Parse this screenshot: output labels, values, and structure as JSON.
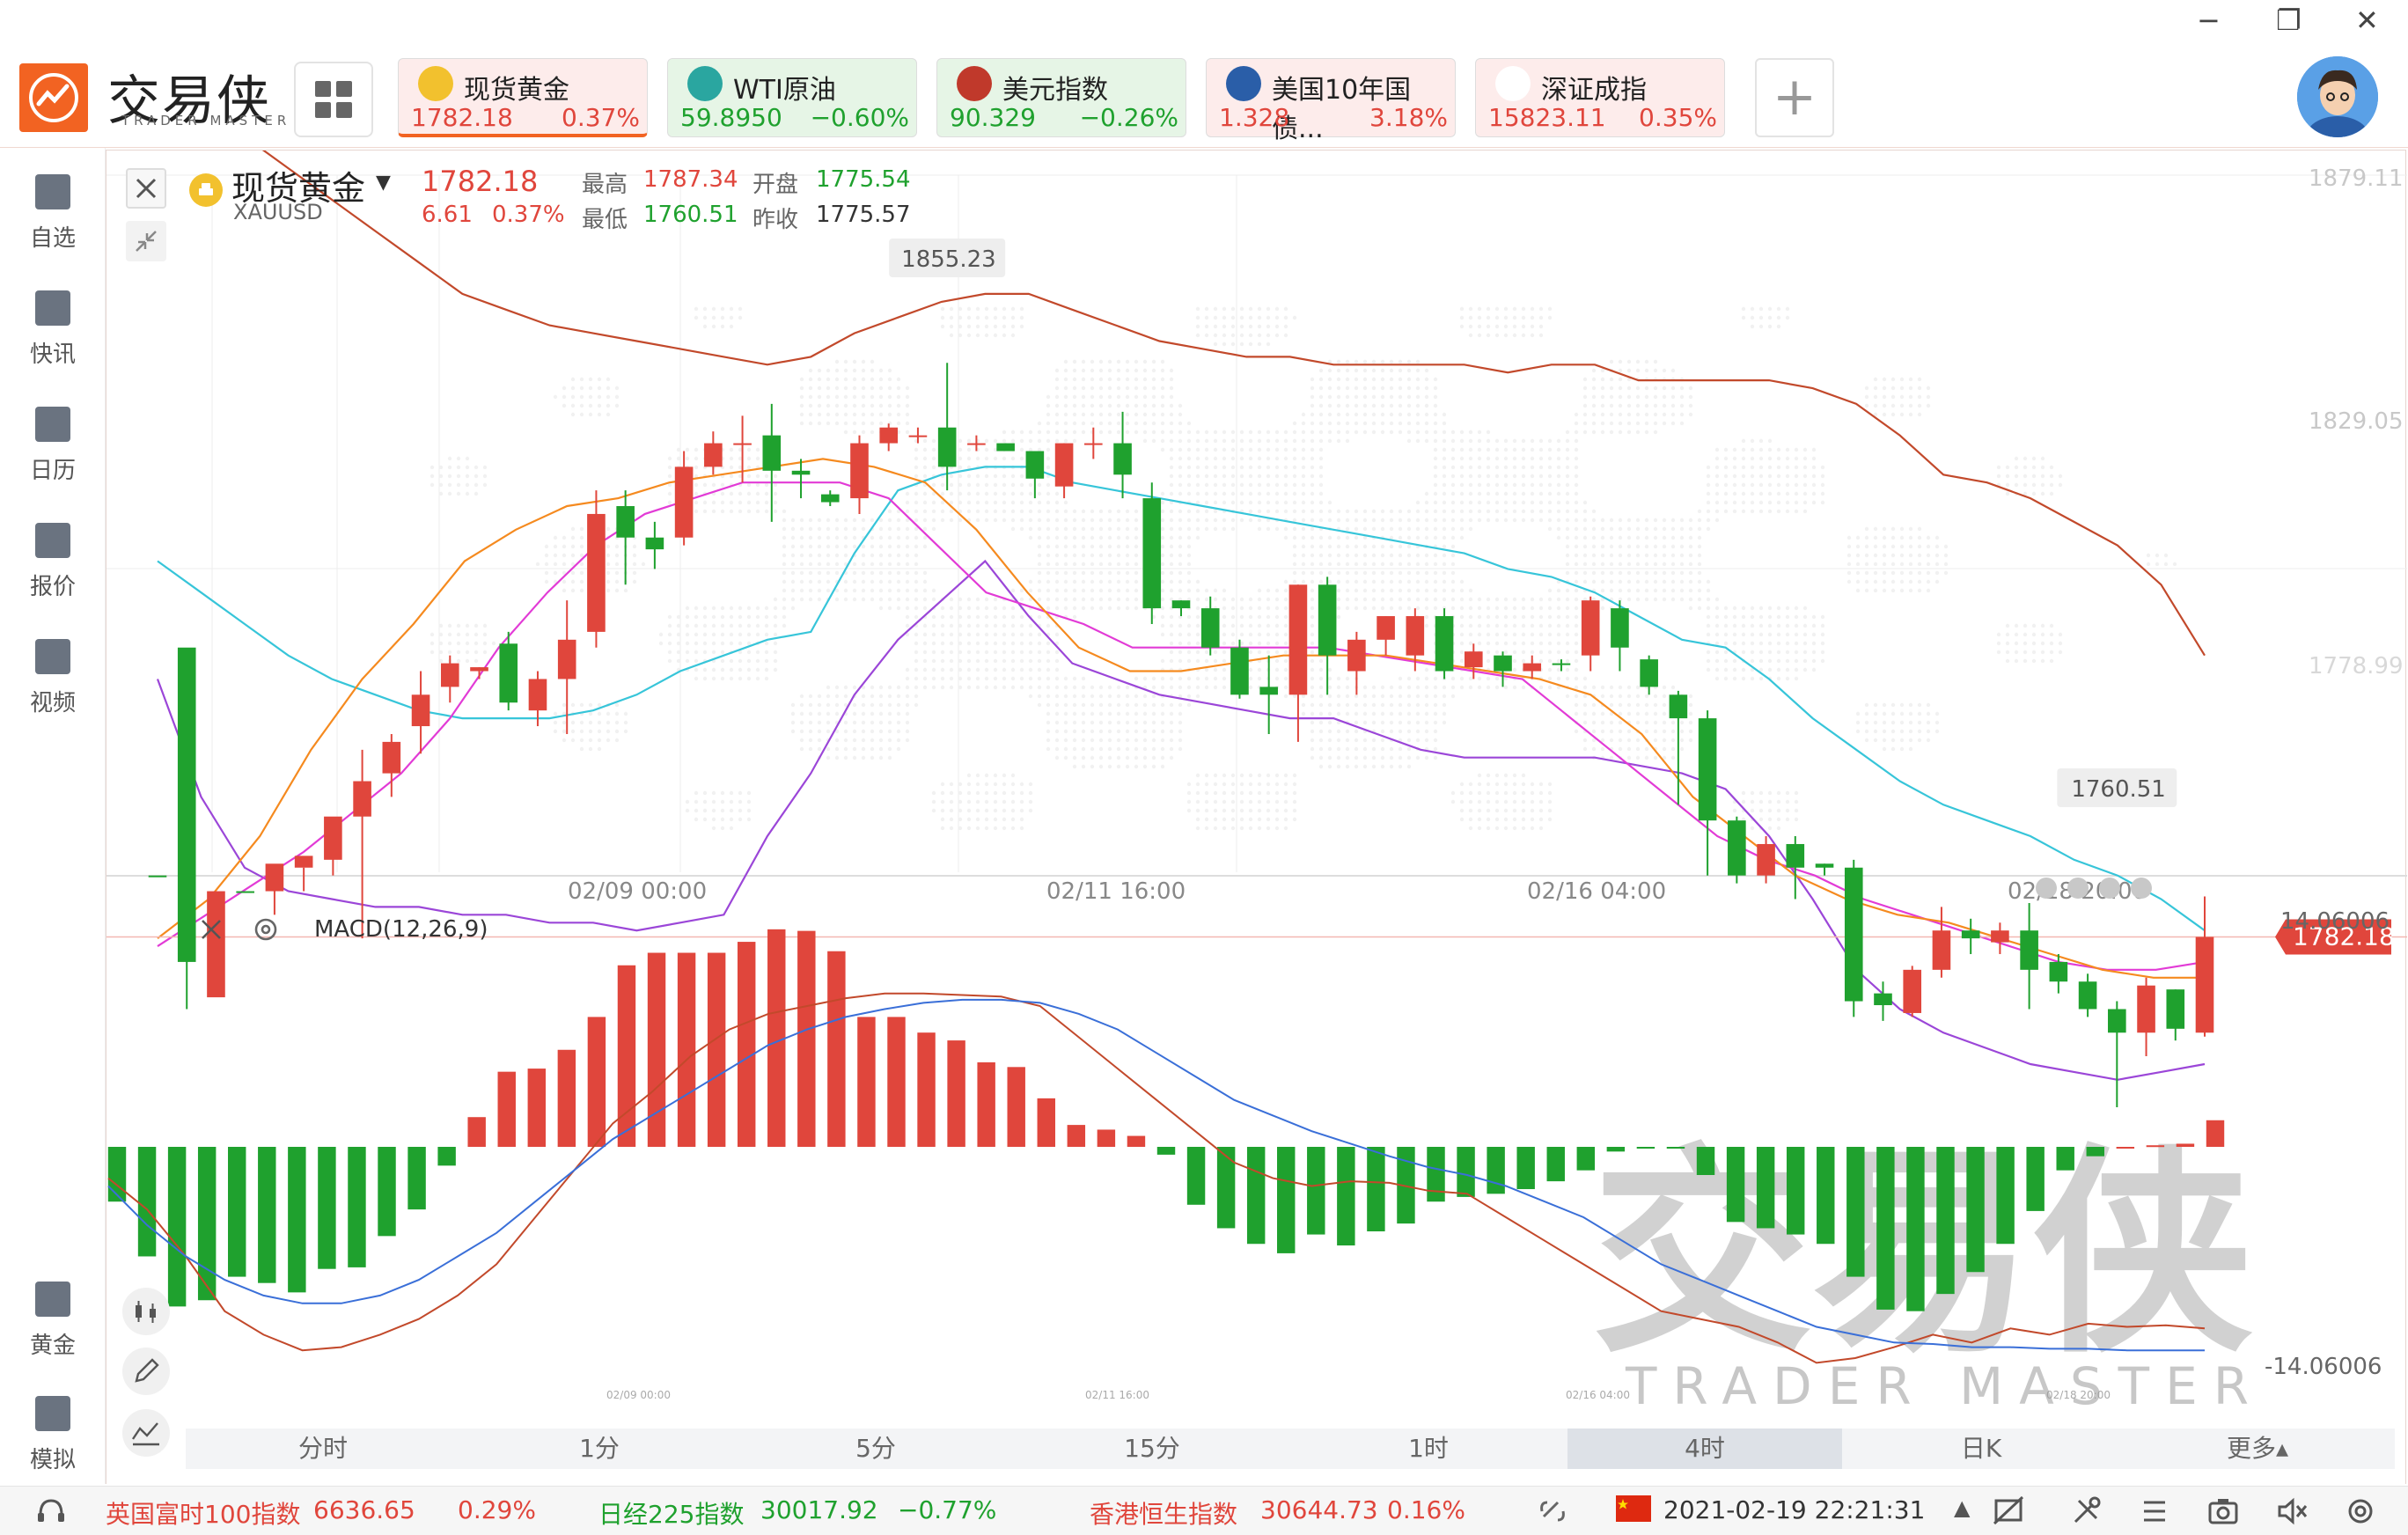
{
  "window": {
    "minimize": "−",
    "restore": "❐",
    "close": "✕"
  },
  "logo": {
    "text": "交易侠",
    "subtitle": "TRADER MASTER"
  },
  "tickers": [
    {
      "name": "现货黄金",
      "price": "1782.18",
      "change": "0.37%",
      "dir": "up",
      "icon": "gold-icon"
    },
    {
      "name": "WTI原油",
      "price": "59.8950",
      "change": "−0.60%",
      "dir": "down",
      "icon": "oil-icon"
    },
    {
      "name": "美元指数",
      "price": "90.329",
      "change": "−0.26%",
      "dir": "down",
      "icon": "us-flag-icon"
    },
    {
      "name": "美国10年国债...",
      "price": "1.328",
      "change": "3.18%",
      "dir": "up",
      "icon": "bond-icon"
    },
    {
      "name": "深证成指",
      "price": "15823.11",
      "change": "0.35%",
      "dir": "up",
      "icon": "szse-icon"
    }
  ],
  "add_label": "+",
  "sidebar": {
    "items": [
      {
        "label": "自选",
        "icon": "bookmark-icon"
      },
      {
        "label": "快讯",
        "icon": "news-icon"
      },
      {
        "label": "日历",
        "icon": "calendar-icon"
      },
      {
        "label": "报价",
        "icon": "quote-icon"
      },
      {
        "label": "视频",
        "icon": "video-icon"
      }
    ],
    "bottom_items": [
      {
        "label": "黄金",
        "icon": "sge-icon"
      },
      {
        "label": "模拟",
        "icon": "wallet-icon"
      }
    ]
  },
  "symbol": {
    "name": "现货黄金",
    "code": "XAUUSD",
    "price": "1782.18",
    "change": "6.61",
    "change_pct": "0.37%",
    "high_label": "最高",
    "high": "1787.34",
    "open_label": "开盘",
    "open": "1775.54",
    "low_label": "最低",
    "low": "1760.51",
    "prev_label": "昨收",
    "prev": "1775.57"
  },
  "price_axis": {
    "top": "1879.11",
    "mid": "1829.05",
    "current": "1782.18",
    "behind": "1778.99"
  },
  "annotations": {
    "max": "1855.23",
    "min": "1760.51"
  },
  "x_labels": [
    "02/09 00:00",
    "02/11 16:00",
    "02/16 04:00",
    "02/18 20:00"
  ],
  "macd": {
    "title": "MACD(12,26,9)",
    "top": "14.06006",
    "bottom": "-14.06006"
  },
  "watermark": {
    "main": "交易侠",
    "sub": "TRADER MASTER"
  },
  "timeframes": [
    "分时",
    "1分",
    "5分",
    "15分",
    "1时",
    "4时",
    "日K",
    "更多▴"
  ],
  "active_timeframe": "4时",
  "status": [
    {
      "name": "英国富时100指数",
      "value": "6636.65",
      "change": "0.29%",
      "dir": "up"
    },
    {
      "name": "日经225指数",
      "value": "30017.92",
      "change": "−0.77%",
      "dir": "down"
    },
    {
      "name": "香港恒生指数",
      "value": "30644.73",
      "change": "0.16%",
      "dir": "up"
    }
  ],
  "datetime": "2021-02-19 22:21:31",
  "colors": {
    "up": "#e0463c",
    "down": "#1fa12e",
    "accent": "#f26322"
  },
  "chart_data": {
    "type": "candlestick",
    "candles": [
      [
        1790.0,
        1790.0,
        1790.0,
        1790.0,
        "g"
      ],
      [
        1779.0,
        1819.0,
        1818.0,
        1773.0,
        "g"
      ],
      [
        1774.5,
        1788.0,
        1779.0,
        1775.0,
        "r"
      ],
      [
        1788.0,
        1788.0,
        1787.0,
        1787.0,
        "g"
      ],
      [
        1788.0,
        1791.5,
        1788.5,
        1785.0,
        "r"
      ],
      [
        1791.0,
        1792.5,
        1788.0,
        1791.0,
        "r"
      ],
      [
        1792.0,
        1797.5,
        1793.5,
        1790.0,
        "r"
      ],
      [
        1797.5,
        1802.0,
        1806.0,
        1782.0,
        "r"
      ],
      [
        1803.0,
        1807.0,
        1808.0,
        1800.0,
        "r"
      ],
      [
        1809.0,
        1813.0,
        1816.0,
        1805.5,
        "r"
      ],
      [
        1814.0,
        1817.0,
        1818.0,
        1812.0,
        "r"
      ],
      [
        1816.0,
        1816.5,
        1816.5,
        1815.0,
        "r"
      ],
      [
        1819.5,
        1812.0,
        1821.0,
        1811.0,
        "g"
      ],
      [
        1811.0,
        1815.0,
        1816.0,
        1809.0,
        "r"
      ],
      [
        1815.0,
        1820.0,
        1825.0,
        1808.0,
        "r"
      ],
      [
        1821.0,
        1836.0,
        1839.0,
        1819.0,
        "r"
      ],
      [
        1837.0,
        1833.0,
        1839.0,
        1827.0,
        "g"
      ],
      [
        1833.0,
        1831.5,
        1835.0,
        1829.0,
        "g"
      ],
      [
        1833.0,
        1842.0,
        1844.0,
        1832.0,
        "r"
      ],
      [
        1842.0,
        1845.0,
        1846.5,
        1841.0,
        "r"
      ],
      [
        1845.0,
        1845.0,
        1848.5,
        1840.0,
        "r"
      ],
      [
        1846.0,
        1841.5,
        1850.0,
        1835.0,
        "g"
      ],
      [
        1841.5,
        1841.0,
        1843.0,
        1838.0,
        "g"
      ],
      [
        1838.5,
        1837.5,
        1839.0,
        1837.0,
        "g"
      ],
      [
        1838.0,
        1845.0,
        1846.0,
        1836.0,
        "r"
      ],
      [
        1845.0,
        1847.0,
        1847.5,
        1844.0,
        "r"
      ],
      [
        1846.0,
        1846.0,
        1847.0,
        1845.0,
        "r"
      ],
      [
        1847.0,
        1842.0,
        1855.23,
        1839.0,
        "g"
      ],
      [
        1845.0,
        1845.0,
        1846.0,
        1844.0,
        "r"
      ],
      [
        1845.0,
        1844.0,
        1845.0,
        1844.0,
        "g"
      ],
      [
        1844.0,
        1840.5,
        1844.0,
        1838.0,
        "g"
      ],
      [
        1839.5,
        1845.0,
        1845.0,
        1838.0,
        "r"
      ],
      [
        1845.0,
        1845.0,
        1847.0,
        1843.0,
        "r"
      ],
      [
        1845.0,
        1841.0,
        1849.0,
        1838.0,
        "g"
      ],
      [
        1838.0,
        1824.0,
        1840.0,
        1822.0,
        "g"
      ],
      [
        1825.0,
        1824.0,
        1825.0,
        1823.0,
        "g"
      ],
      [
        1824.0,
        1819.0,
        1825.5,
        1818.0,
        "g"
      ],
      [
        1819.0,
        1813.0,
        1820.0,
        1812.5,
        "g"
      ],
      [
        1814.0,
        1813.0,
        1818.0,
        1808.0,
        "g"
      ],
      [
        1813.0,
        1827.0,
        1827.0,
        1807.0,
        "r"
      ],
      [
        1827.0,
        1818.0,
        1828.0,
        1813.0,
        "g"
      ],
      [
        1816.0,
        1820.0,
        1821.0,
        1813.0,
        "r"
      ],
      [
        1820.0,
        1823.0,
        1823.0,
        1818.0,
        "r"
      ],
      [
        1818.0,
        1823.0,
        1824.0,
        1816.0,
        "r"
      ],
      [
        1823.0,
        1816.0,
        1824.0,
        1815.0,
        "g"
      ],
      [
        1816.5,
        1818.5,
        1819.5,
        1815.0,
        "r"
      ],
      [
        1818.0,
        1816.0,
        1818.5,
        1814.0,
        "g"
      ],
      [
        1816.0,
        1817.0,
        1818.0,
        1815.0,
        "r"
      ],
      [
        1817.0,
        1817.0,
        1817.5,
        1816.0,
        "g"
      ],
      [
        1818.0,
        1825.0,
        1825.5,
        1816.0,
        "r"
      ],
      [
        1824.0,
        1819.0,
        1825.0,
        1816.0,
        "g"
      ],
      [
        1817.5,
        1814.0,
        1818.0,
        1813.0,
        "g"
      ],
      [
        1813.0,
        1810.0,
        1813.5,
        1799.0,
        "g"
      ],
      [
        1810.0,
        1797.0,
        1811.0,
        1790.0,
        "g"
      ],
      [
        1797.0,
        1790.0,
        1797.5,
        1789.0,
        "g"
      ],
      [
        1790.0,
        1794.0,
        1795.0,
        1789.0,
        "r"
      ],
      [
        1794.0,
        1791.0,
        1795.0,
        1787.0,
        "g"
      ],
      [
        1791.5,
        1791.0,
        1791.5,
        1790.0,
        "g"
      ],
      [
        1791.0,
        1774.0,
        1792.0,
        1772.0,
        "g"
      ],
      [
        1775.0,
        1773.5,
        1776.5,
        1771.5,
        "g"
      ],
      [
        1772.5,
        1778.0,
        1778.5,
        1772.0,
        "r"
      ],
      [
        1778.0,
        1783.0,
        1786.0,
        1777.0,
        "r"
      ],
      [
        1783.0,
        1782.0,
        1784.5,
        1780.0,
        "g"
      ],
      [
        1781.5,
        1783.0,
        1784.0,
        1780.0,
        "r"
      ],
      [
        1783.0,
        1778.0,
        1786.5,
        1773.0,
        "g"
      ],
      [
        1779.0,
        1776.5,
        1780.0,
        1775.0,
        "g"
      ],
      [
        1776.5,
        1773.0,
        1777.5,
        1772.0,
        "g"
      ],
      [
        1773.0,
        1770.0,
        1774.0,
        1760.51,
        "g"
      ],
      [
        1770.0,
        1776.0,
        1777.0,
        1767.0,
        "r"
      ],
      [
        1775.5,
        1770.5,
        1775.5,
        1769.0,
        "g"
      ],
      [
        1770.0,
        1782.18,
        1787.34,
        1769.5,
        "r"
      ]
    ],
    "macd_hist": [
      -3.5,
      -7,
      -10.2,
      -9.8,
      -8.3,
      -8.7,
      -9.3,
      -7.8,
      -7.7,
      -5.7,
      -4,
      -1.2,
      1.9,
      4.8,
      5,
      6.2,
      8.3,
      11.6,
      12.4,
      12.4,
      12.4,
      13.1,
      13.9,
      13.8,
      12.5,
      8.3,
      8.3,
      7.3,
      6.8,
      5.4,
      5.1,
      3.1,
      1.4,
      1.1,
      0.7,
      -0.5,
      -3.7,
      -5.2,
      -6.2,
      -6.8,
      -5.6,
      -6.3,
      -5.4,
      -4.9,
      -3.5,
      -3.2,
      -3,
      -2.7,
      -2.2,
      -1.5,
      -0.3,
      -0.1,
      -0.1,
      -1.8,
      -4.8,
      -5.2,
      -5.6,
      -6.2,
      -8.3,
      -10.4,
      -10.5,
      -9.4,
      -8,
      -6.2,
      -4.1,
      -1.5,
      -0.6,
      0,
      0.1,
      0.2,
      1.7
    ],
    "dif": [
      -2.0,
      -4.0,
      -7.0,
      -10.5,
      -12.0,
      -13.0,
      -12.8,
      -12.0,
      -11.0,
      -9.5,
      -7.5,
      -4.5,
      -1.5,
      1.5,
      3.5,
      5.8,
      7.5,
      8.5,
      9.0,
      9.5,
      9.8,
      9.8,
      9.7,
      9.6,
      9.0,
      7.0,
      5.0,
      3.0,
      1.0,
      -1.0,
      -2.0,
      -2.5,
      -2.2,
      -2.3,
      -2.8,
      -3.0,
      -4.5,
      -6.0,
      -7.5,
      -9.0,
      -10.5,
      -11.0,
      -11.5,
      -12.5,
      -13.8,
      -13.5,
      -12.8,
      -12.0,
      -12.5,
      -11.6,
      -12.0,
      -11.3,
      -11.5,
      -11.4,
      -11.6
    ],
    "dea": [
      -2.5,
      -5.0,
      -7.0,
      -8.5,
      -9.5,
      -10.0,
      -10.0,
      -9.5,
      -8.5,
      -7.0,
      -5.5,
      -3.5,
      -1.5,
      0.5,
      2.0,
      3.5,
      5.0,
      6.5,
      7.5,
      8.3,
      8.8,
      9.2,
      9.4,
      9.4,
      9.2,
      8.5,
      7.5,
      6.0,
      4.5,
      3.0,
      2.0,
      1.0,
      0.2,
      -0.6,
      -1.3,
      -1.8,
      -2.5,
      -3.5,
      -4.5,
      -6.0,
      -7.5,
      -8.5,
      -9.5,
      -10.5,
      -11.5,
      -12.0,
      -12.5,
      -12.6,
      -12.8,
      -12.8,
      -12.9,
      -12.9,
      -13.0,
      -13.0,
      -13.0
    ],
    "boll_upper": [
      1888,
      1886,
      1884,
      1880,
      1876,
      1872,
      1868,
      1864,
      1862,
      1860,
      1859,
      1858,
      1857,
      1856,
      1855,
      1856,
      1859,
      1861,
      1863,
      1864,
      1864,
      1862,
      1860,
      1858,
      1857,
      1856,
      1856,
      1855,
      1855,
      1855,
      1855,
      1854,
      1855,
      1855,
      1853,
      1853,
      1853,
      1853,
      1852,
      1850,
      1846,
      1841,
      1840,
      1838,
      1835,
      1832,
      1827,
      1818
    ],
    "boll_mid": [
      1830,
      1826,
      1822,
      1818,
      1815,
      1813,
      1811,
      1810,
      1810,
      1810,
      1811,
      1813,
      1816,
      1818,
      1820,
      1821,
      1831,
      1839,
      1841,
      1842,
      1842,
      1840,
      1839,
      1838,
      1837,
      1836,
      1835,
      1834,
      1833,
      1832,
      1831,
      1829,
      1828,
      1826,
      1823,
      1820,
      1819,
      1815,
      1810,
      1806,
      1802,
      1799,
      1797,
      1795,
      1792,
      1790,
      1787,
      1783
    ],
    "boll_lower": [
      1815,
      1800,
      1791,
      1788,
      1787,
      1786,
      1786,
      1785,
      1785,
      1784,
      1784,
      1783,
      1784,
      1785,
      1795,
      1803,
      1813,
      1820,
      1825,
      1830,
      1823,
      1817,
      1815,
      1813,
      1812,
      1811,
      1810,
      1810,
      1808,
      1806,
      1805,
      1805,
      1805,
      1805,
      1804,
      1803,
      1801,
      1795,
      1787,
      1778,
      1773,
      1770,
      1768,
      1766,
      1765,
      1764,
      1765,
      1766
    ],
    "ma_fast": [
      1782,
      1787,
      1795,
      1806,
      1815,
      1822,
      1830,
      1834,
      1837,
      1838,
      1840,
      1841,
      1842,
      1843,
      1842,
      1840,
      1834,
      1826,
      1819,
      1816,
      1816,
      1817,
      1818,
      1818,
      1818,
      1817,
      1816,
      1815,
      1813,
      1808,
      1800,
      1795,
      1790,
      1787,
      1785,
      1784,
      1782,
      1780,
      1778,
      1777,
      1777
    ],
    "ma_slow": [
      1781,
      1785,
      1789,
      1793,
      1798,
      1803,
      1810,
      1819,
      1826,
      1832,
      1836,
      1838,
      1840,
      1840,
      1840,
      1838,
      1832,
      1826,
      1824,
      1822,
      1819,
      1819,
      1819,
      1819,
      1819,
      1818,
      1817,
      1816,
      1815,
      1810,
      1805,
      1800,
      1795,
      1792,
      1790,
      1787,
      1785,
      1783,
      1781,
      1779,
      1778,
      1778,
      1779
    ]
  }
}
